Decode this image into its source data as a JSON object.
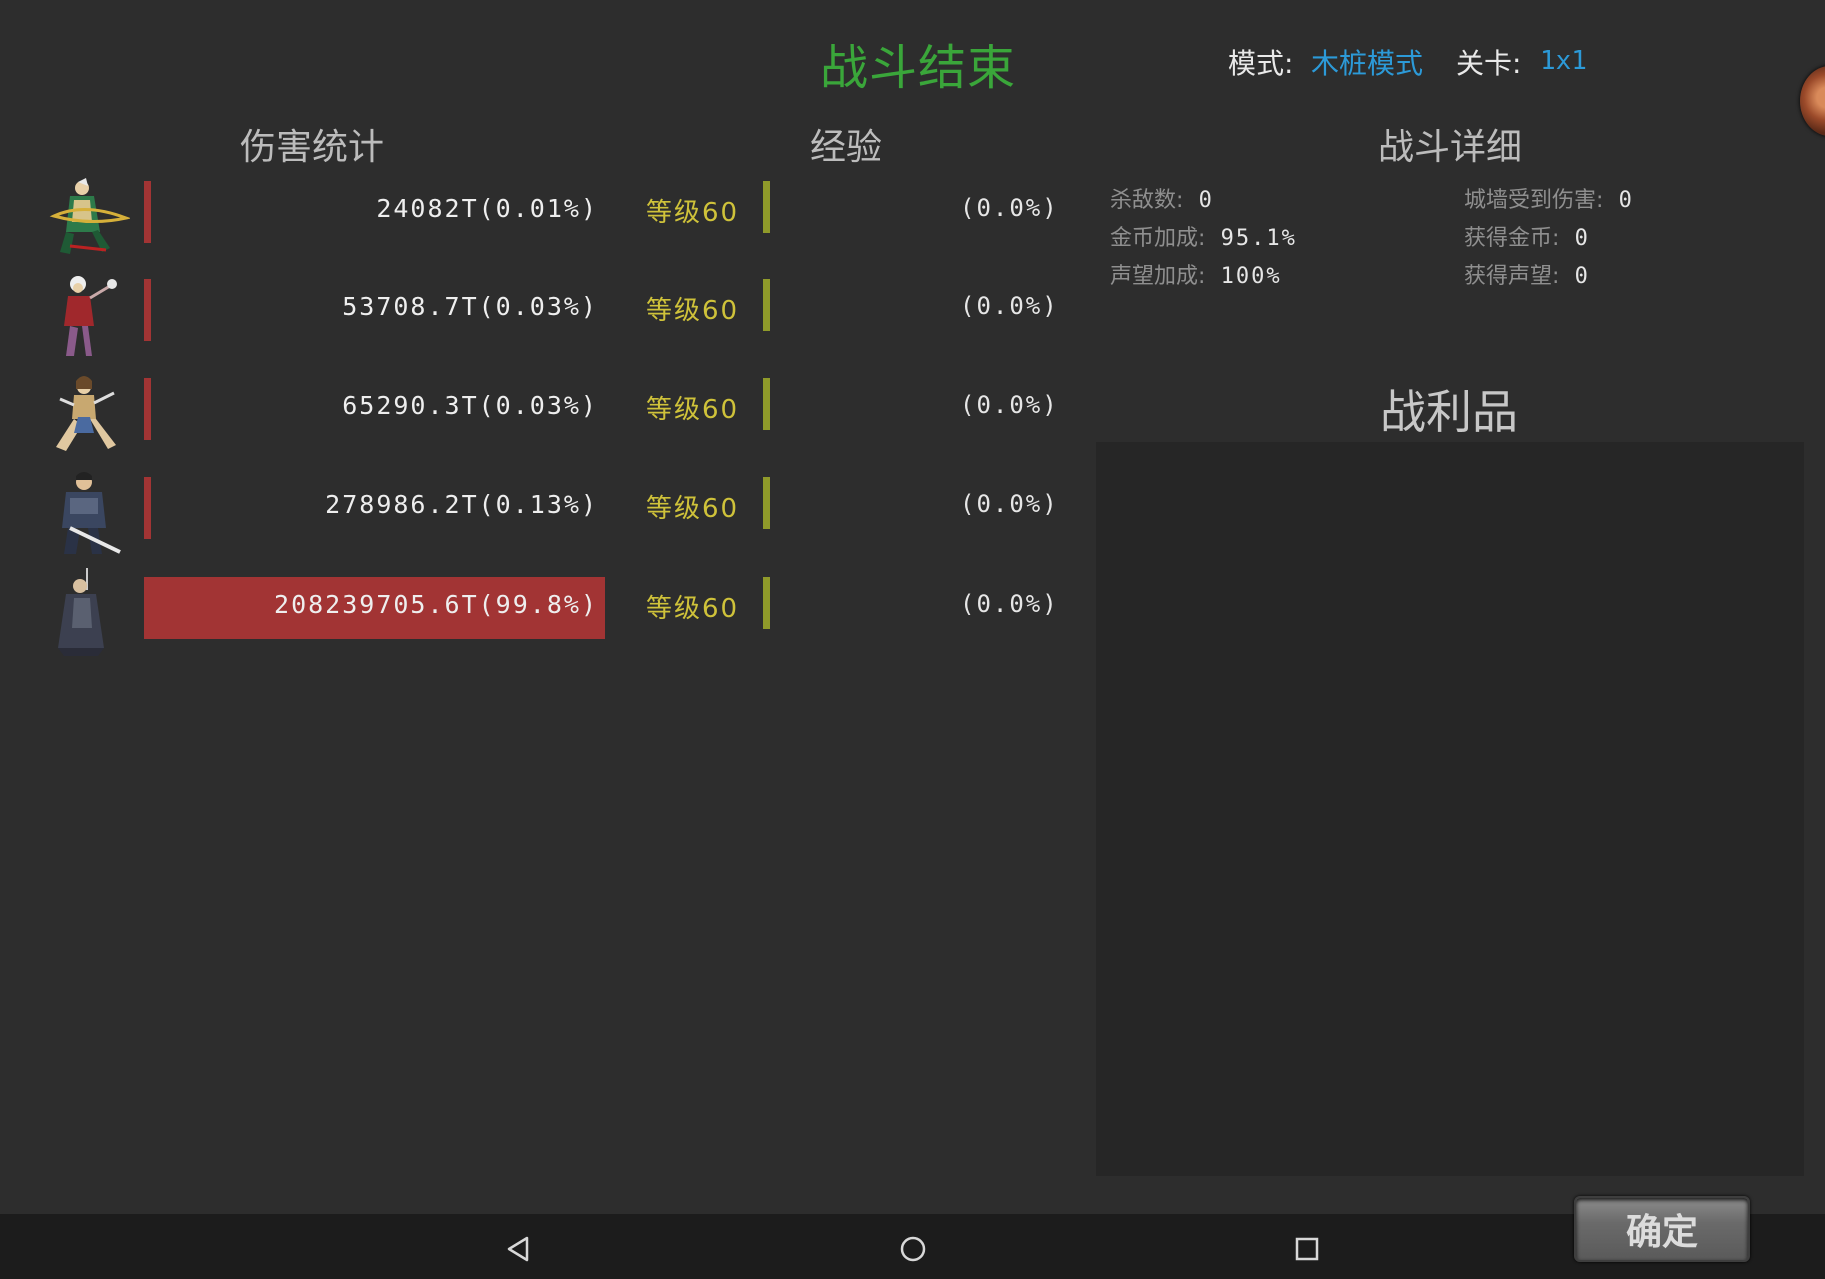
{
  "header": {
    "title": "战斗结束",
    "mode_label": "模式:",
    "mode_value": "木桩模式",
    "stage_label": "关卡:",
    "stage_value": "1x1"
  },
  "sections": {
    "damage_stats": "伤害统计",
    "experience": "经验",
    "battle_detail": "战斗详细",
    "loot": "战利品"
  },
  "heroes": [
    {
      "icon": "archer-hero-icon",
      "damage": "24082T(0.01%)",
      "damage_share": 0.0001,
      "level": "等级60",
      "exp": "(0.0%)",
      "exp_share": 0.0
    },
    {
      "icon": "mage-hero-icon",
      "damage": "53708.7T(0.03%)",
      "damage_share": 0.0003,
      "level": "等级60",
      "exp": "(0.0%)",
      "exp_share": 0.0
    },
    {
      "icon": "warrior-woman-hero-icon",
      "damage": "65290.3T(0.03%)",
      "damage_share": 0.0003,
      "level": "等级60",
      "exp": "(0.0%)",
      "exp_share": 0.0
    },
    {
      "icon": "armored-swordsman-hero-icon",
      "damage": "278986.2T(0.13%)",
      "damage_share": 0.0013,
      "level": "等级60",
      "exp": "(0.0%)",
      "exp_share": 0.0
    },
    {
      "icon": "cloaked-knight-hero-icon",
      "damage": "208239705.6T(99.8%)",
      "damage_share": 0.998,
      "level": "等级60",
      "exp": "(0.0%)",
      "exp_share": 0.0
    }
  ],
  "battle_detail": {
    "kills": {
      "label": "杀敌数:",
      "value": "0"
    },
    "wall_damage": {
      "label": "城墙受到伤害:",
      "value": "0"
    },
    "gold_bonus": {
      "label": "金币加成:",
      "value": "95.1%"
    },
    "gold_gained": {
      "label": "获得金币:",
      "value": "0"
    },
    "fame_bonus": {
      "label": "声望加成:",
      "value": "100%"
    },
    "fame_gained": {
      "label": "获得声望:",
      "value": "0"
    }
  },
  "loot_items": [],
  "confirm_label": "确定",
  "colors": {
    "title_green": "#3aa63a",
    "link_blue": "#2c9ad8",
    "damage_red": "#a23434",
    "level_gold": "#cfc23a",
    "exp_olive": "#8f9a2a"
  },
  "nav": {
    "back_icon": "back-triangle-icon",
    "home_icon": "home-circle-icon",
    "recents_icon": "recents-square-icon"
  }
}
